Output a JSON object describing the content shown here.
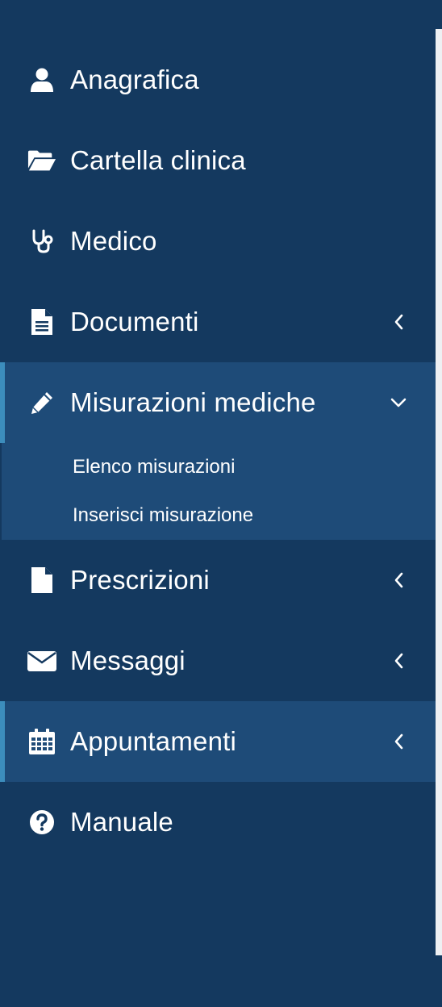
{
  "sidebar": {
    "items": [
      {
        "label": "Anagrafica",
        "icon": "user-icon"
      },
      {
        "label": "Cartella clinica",
        "icon": "folder-open-icon"
      },
      {
        "label": "Medico",
        "icon": "stethoscope-icon"
      },
      {
        "label": "Documenti",
        "icon": "file-text-icon",
        "chevron": "chevron-left-icon"
      },
      {
        "label": "Misurazioni mediche",
        "icon": "pencil-icon",
        "chevron": "chevron-down-icon",
        "expanded": true,
        "subitems": [
          {
            "label": "Elenco misurazioni"
          },
          {
            "label": "Inserisci misurazione"
          }
        ]
      },
      {
        "label": "Prescrizioni",
        "icon": "file-icon",
        "chevron": "chevron-left-icon"
      },
      {
        "label": "Messaggi",
        "icon": "envelope-icon",
        "chevron": "chevron-left-icon"
      },
      {
        "label": "Appuntamenti",
        "icon": "calendar-icon",
        "chevron": "chevron-left-icon",
        "active": true
      },
      {
        "label": "Manuale",
        "icon": "question-circle-icon"
      }
    ]
  },
  "colors": {
    "sidebar_bg": "#14395f",
    "active_bg": "#1e4b78",
    "active_indicator": "#3c8dbc",
    "text": "#ffffff"
  }
}
